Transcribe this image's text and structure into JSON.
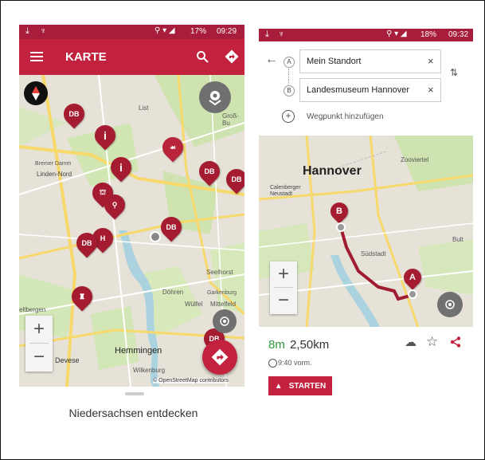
{
  "left": {
    "status": {
      "download": "⤓",
      "usb": "♆",
      "signal": "⚲ ▾ ◢",
      "battery": "17%",
      "time": "09:29"
    },
    "appbar": {
      "title": "KARTE"
    },
    "map": {
      "labels": {
        "linden_nord": "Linden-Nord",
        "bremer_damm": "Bremer Damm",
        "hemmingen": "Hemmingen",
        "devese": "Devese",
        "wilkenburg": "Wilkenburg",
        "doehren": "Döhren",
        "wulfel": "Wülfel",
        "mittelfeld": "Mittelfeld",
        "seelhorst": "Seelhorst",
        "gross_bu": "Groß-Bu",
        "list": "List",
        "arkenburg": "Garkenburg",
        "eltbergen": "eltbergen",
        "attribution": "© OpenStreetMap contributors"
      },
      "pins": [
        "DB",
        "i",
        "DB",
        "DB",
        "DB",
        "i",
        "DB",
        "DB",
        "H"
      ]
    },
    "bottom": {
      "title": "Niedersachsen entdecken"
    }
  },
  "right": {
    "status": {
      "download": "⤓",
      "usb": "♆",
      "signal": "⚲ ▾ ◢",
      "battery": "18%",
      "time": "09:32"
    },
    "route": {
      "marker_a": "A",
      "marker_b": "B",
      "from": "Mein Standort",
      "to": "Landesmuseum Hannover",
      "waypoint": "Wegpunkt hinzufügen"
    },
    "map": {
      "labels": {
        "hannover": "Hannover",
        "calenberger": "Calenberger\nNeustadt",
        "suedstadt": "Südstadt",
        "zooviertel": "Zooviertel",
        "bult": "Bult",
        "marker_a": "A",
        "marker_b": "B"
      }
    },
    "summary": {
      "time": "8m",
      "distance": "2,50km",
      "clock": "9:40 vorm.",
      "start": "STARTEN"
    }
  },
  "colors": {
    "brand": "#c3223f",
    "status": "#a81d3b",
    "duration_green": "#2e9a3e"
  }
}
